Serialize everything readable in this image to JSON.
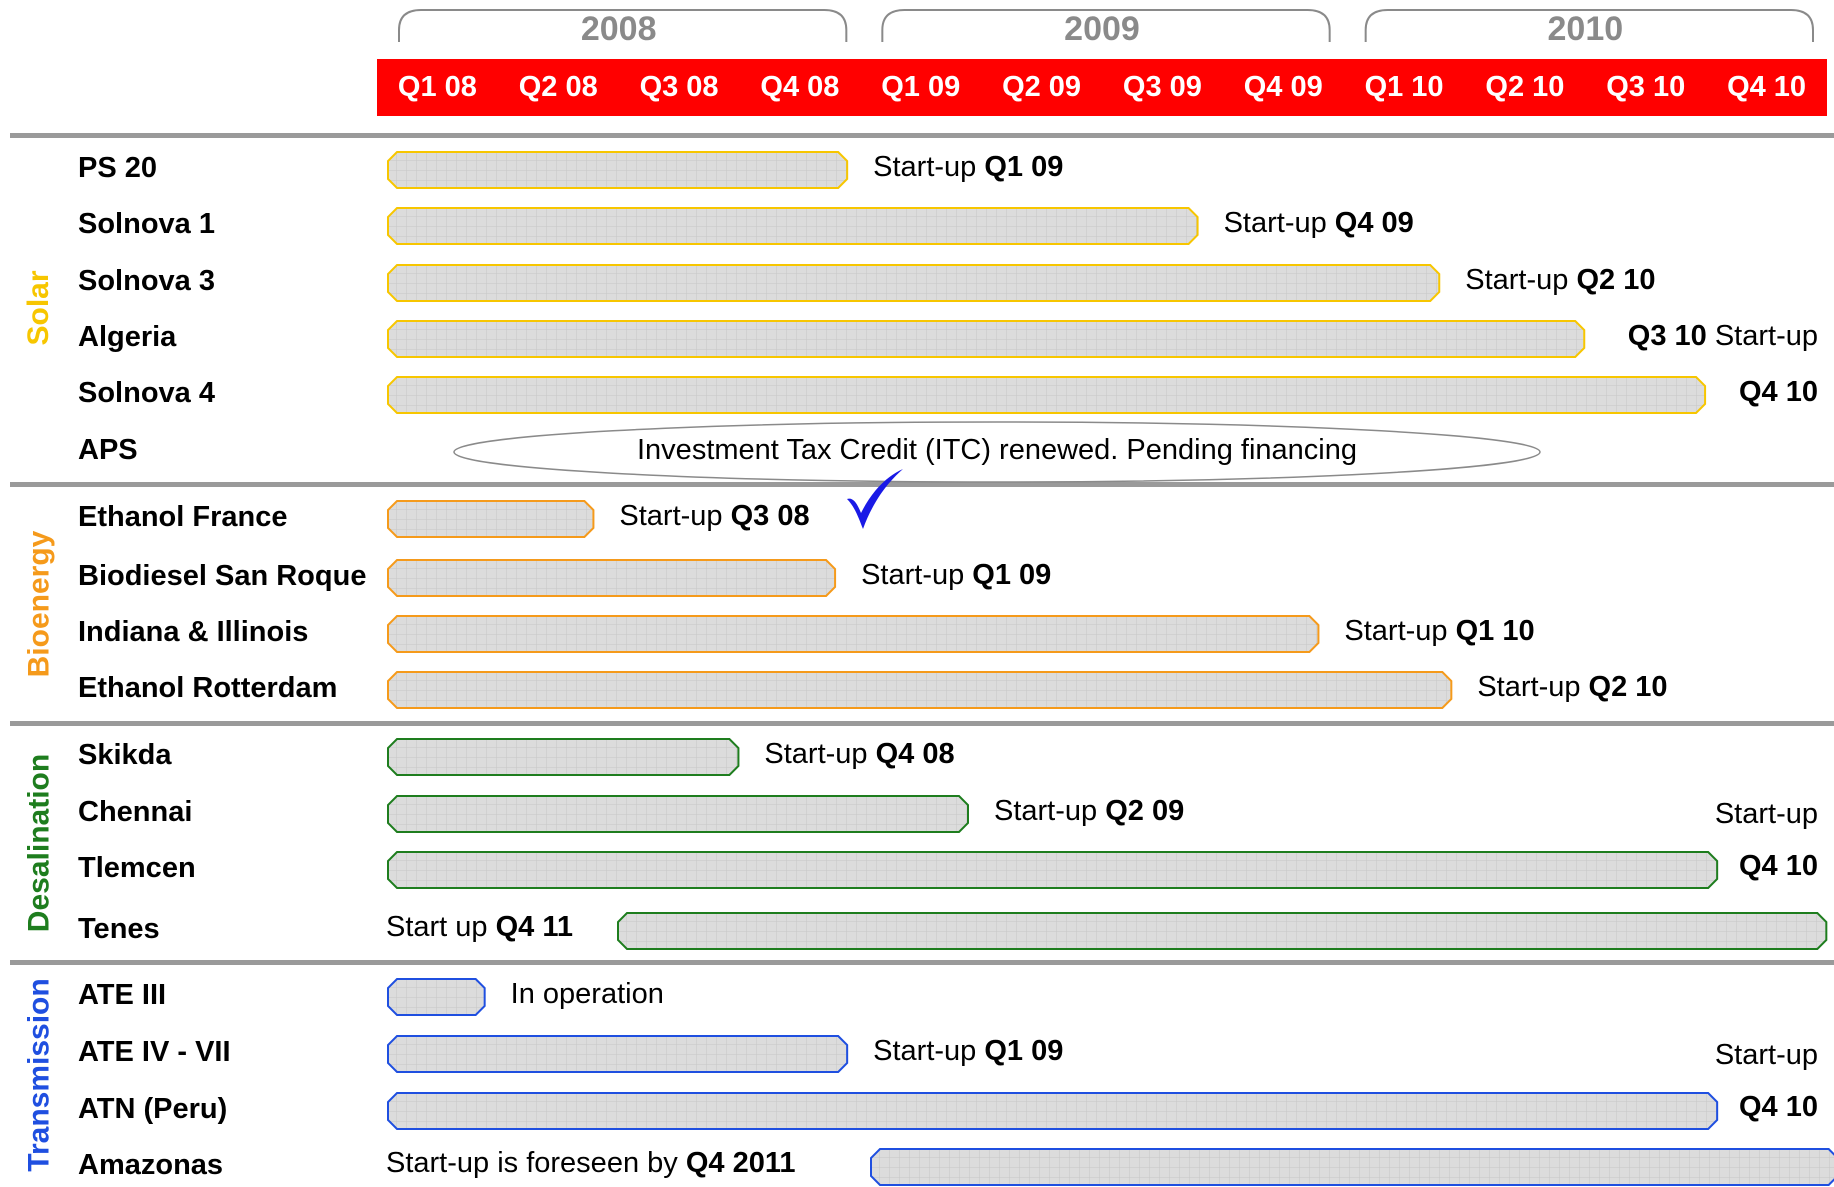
{
  "years": [
    "2008",
    "2009",
    "2010"
  ],
  "quarters": [
    "Q1 08",
    "Q2 08",
    "Q3 08",
    "Q4 08",
    "Q1 09",
    "Q2 09",
    "Q3 09",
    "Q4 09",
    "Q1 10",
    "Q2 10",
    "Q3 10",
    "Q4 10"
  ],
  "colors": {
    "header": "#ff0000",
    "solar": "#f7c600",
    "bioenergy": "#f59a1b",
    "desalination": "#1e7d1e",
    "transmission": "#1f4fe0",
    "bar_fill": "#dcdcdc",
    "check": "#1a1ae6"
  },
  "sectors": [
    {
      "key": "solar",
      "label": "Solar"
    },
    {
      "key": "bioenergy",
      "label": "Bioenergy"
    },
    {
      "key": "desalination",
      "label": "Desalination"
    },
    {
      "key": "transmission",
      "label": "Transmission"
    }
  ],
  "projects": [
    {
      "sector": "solar",
      "name": "PS 20",
      "start_q": 0,
      "end_q": 3.8,
      "status_pre": "Start-up ",
      "status_bold": "Q1 09"
    },
    {
      "sector": "solar",
      "name": "Solnova 1",
      "start_q": 0,
      "end_q": 6.7,
      "status_pre": "Start-up ",
      "status_bold": "Q4 09"
    },
    {
      "sector": "solar",
      "name": "Solnova 3",
      "start_q": 0,
      "end_q": 8.7,
      "status_pre": "Start-up ",
      "status_bold": "Q2 10"
    },
    {
      "sector": "solar",
      "name": "Algeria",
      "start_q": 0,
      "end_q": 9.9,
      "status_pre": "",
      "status_bold": "Q3 10",
      "status_post": " Start-up"
    },
    {
      "sector": "solar",
      "name": "Solnova 4",
      "start_q": 0,
      "end_q": 10.9,
      "status_pre": "",
      "status_bold": "Q4 10"
    },
    {
      "sector": "solar",
      "name": "APS",
      "note": "Investment Tax Credit (ITC) renewed. Pending financing"
    },
    {
      "sector": "bioenergy",
      "name": "Ethanol France",
      "start_q": 0,
      "end_q": 1.7,
      "status_pre": "Start-up ",
      "status_bold": "Q3 08",
      "check": true
    },
    {
      "sector": "bioenergy",
      "name": "Biodiesel San Roque",
      "start_q": 0,
      "end_q": 3.7,
      "status_pre": "Start-up ",
      "status_bold": "Q1 09"
    },
    {
      "sector": "bioenergy",
      "name": "Indiana & Illinois",
      "start_q": 0,
      "end_q": 7.7,
      "status_pre": "Start-up ",
      "status_bold": "Q1 10"
    },
    {
      "sector": "bioenergy",
      "name": "Ethanol Rotterdam",
      "start_q": 0,
      "end_q": 8.8,
      "status_pre": "Start-up ",
      "status_bold": "Q2 10"
    },
    {
      "sector": "desalination",
      "name": "Skikda",
      "start_q": 0,
      "end_q": 2.9,
      "status_pre": "Start-up ",
      "status_bold": "Q4 08"
    },
    {
      "sector": "desalination",
      "name": "Chennai",
      "start_q": 0,
      "end_q": 4.8,
      "status_pre": "Start-up ",
      "status_bold": "Q2 09"
    },
    {
      "sector": "desalination",
      "name": "Tlemcen",
      "start_q": 0,
      "end_q": 11.0,
      "status_pre": "Start-up",
      "status_bold": "Q4 10",
      "stacked": true
    },
    {
      "sector": "desalination",
      "name": "Tenes",
      "start_q": 1.9,
      "end_q": 11.9,
      "status_pre": "Start up ",
      "status_bold": "Q4 11",
      "label_left": true
    },
    {
      "sector": "transmission",
      "name": "ATE III",
      "start_q": 0,
      "end_q": 0.8,
      "status_pre": "In operation",
      "status_bold": ""
    },
    {
      "sector": "transmission",
      "name": "ATE IV - VII",
      "start_q": 0,
      "end_q": 3.8,
      "status_pre": "Start-up ",
      "status_bold": "Q1 09"
    },
    {
      "sector": "transmission",
      "name": "ATN (Peru)",
      "start_q": 0,
      "end_q": 11.0,
      "status_pre": "Start-up",
      "status_bold": "Q4 10",
      "stacked": true
    },
    {
      "sector": "transmission",
      "name": "Amazonas",
      "start_q": 4.0,
      "end_q": 12.0,
      "status_pre": "Start-up is foreseen by ",
      "status_bold": "Q4 2011",
      "label_left": true
    }
  ]
}
